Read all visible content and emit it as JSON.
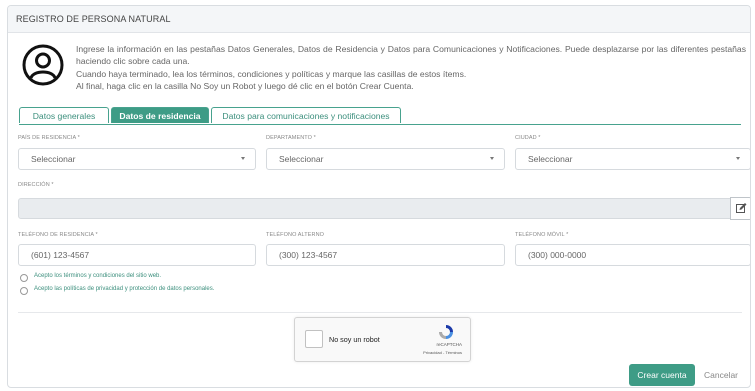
{
  "header": {
    "title": "REGISTRO DE PERSONA NATURAL"
  },
  "intro": {
    "icon": "user-circle-icon",
    "lines": [
      "Ingrese la información en las pestañas Datos Generales, Datos de Residencia y Datos para Comunicaciones y Notificaciones. Puede desplazarse por las diferentes pestañas haciendo clic sobre cada una.",
      "Cuando haya terminado, lea los términos, condiciones y políticas y marque las casillas de estos ítems.",
      "Al final, haga clic en la casilla No Soy un Robot y luego dé clic en el botón Crear Cuenta."
    ]
  },
  "tabs": [
    {
      "label": "Datos generales",
      "active": false
    },
    {
      "label": "Datos de residencia",
      "active": true
    },
    {
      "label": "Datos para comunicaciones y notificaciones",
      "active": false
    }
  ],
  "form": {
    "pais": {
      "label": "PAÍS DE RESIDENCIA *",
      "value": "Seleccionar"
    },
    "departamento": {
      "label": "DEPARTAMENTO *",
      "value": "Seleccionar"
    },
    "ciudad": {
      "label": "CIUDAD *",
      "value": "Seleccionar"
    },
    "direccion": {
      "label": "DIRECCIÓN *",
      "value": "",
      "edit_icon": "edit-icon"
    },
    "telefono_residencia": {
      "label": "TELÉFONO DE RESIDENCIA *",
      "placeholder": "(601) 123-4567"
    },
    "telefono_alterno": {
      "label": "TELÉFONO ALTERNO",
      "placeholder": "(300) 123-4567"
    },
    "telefono_movil": {
      "label": "TELÉFONO MÓVIL *",
      "placeholder": "(300) 000-0000"
    }
  },
  "checks": {
    "terminos": "Acepto los términos y condiciones del sitio web.",
    "politicas": "Acepto las políticas de privacidad y protección de datos personales."
  },
  "captcha": {
    "label": "No soy un robot",
    "brand": "reCAPTCHA",
    "legal": "Privacidad - Términos"
  },
  "actions": {
    "create": "Crear cuenta",
    "cancel": "Cancelar"
  },
  "colors": {
    "accent": "#3e9c86",
    "link": "#3c8f7d"
  }
}
